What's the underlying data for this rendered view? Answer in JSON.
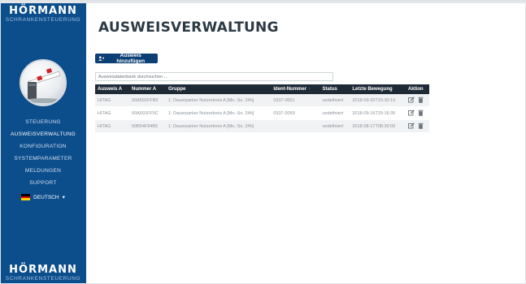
{
  "brand": {
    "name": "HÖRMANN",
    "subtitle": "SCHRANKENSTEUERUNG"
  },
  "sidebar": {
    "items": [
      {
        "label": "STEUERUNG"
      },
      {
        "label": "AUSWEISVERWALTUNG"
      },
      {
        "label": "KONFIGURATION"
      },
      {
        "label": "SYSTEMPARAMETER"
      },
      {
        "label": "MELDUNGEN"
      },
      {
        "label": "SUPPORT"
      }
    ],
    "language": {
      "label": "DEUTSCH",
      "caret": "▾"
    }
  },
  "page": {
    "title": "AUSWEISVERWALTUNG"
  },
  "toolbar": {
    "add_label": "Ausweis hinzufügen",
    "icon": "add-user-icon"
  },
  "search": {
    "placeholder": "Ausweisdatenbank durchsuchen ..."
  },
  "table": {
    "headers": [
      "Ausweis A",
      "Nummer A",
      "Gruppe",
      "Ident-Nummer",
      "Status",
      "Letzte Bewegung",
      "Aktion"
    ],
    "sort_indicator": "↑",
    "rows": [
      {
        "ausweis": "HITAG",
        "nummer": "00A591FFB0",
        "gruppe": "1: Dauerparker Nutzerkreis A [Mo.-So. 24h]",
        "ident": "0337-0001",
        "status": "undefiniert",
        "bewegung": "2018-09-20T15:30:19"
      },
      {
        "ausweis": "HITAG",
        "nummer": "00A591FF5C",
        "gruppe": "1: Dauerparker Nutzerkreis A [Mo.-So. 24h]",
        "ident": "0337-0059",
        "status": "undefiniert",
        "bewegung": "2018-09-16T20:16:35"
      },
      {
        "ausweis": "HITAG",
        "nummer": "00B54F84B5",
        "gruppe": "1: Dauerparker Nutzerkreis A [Mo.-So. 24h]",
        "ident": "",
        "status": "undefiniert",
        "bewegung": "2018-08-17T08:30:00"
      }
    ]
  },
  "colors": {
    "sidebar": "#0c4d8c",
    "header_dark": "#1e2a36",
    "button": "#0c3f74",
    "accent": "#4aa3df"
  }
}
